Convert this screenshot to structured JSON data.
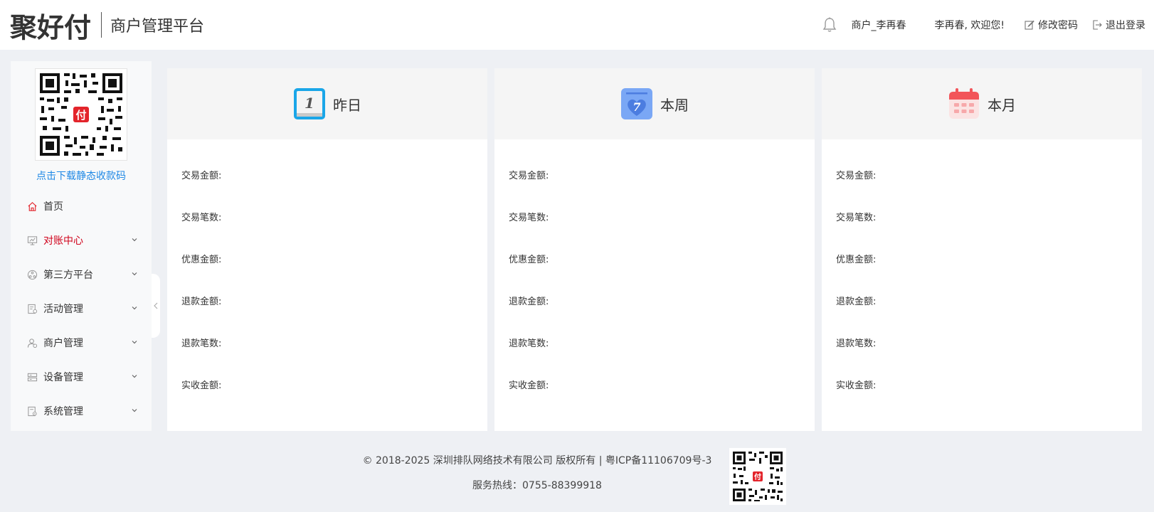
{
  "header": {
    "logo_text": "聚好付",
    "platform_title": "商户管理平台",
    "merchant_name": "商户_李再春",
    "welcome": "李再春, 欢迎您!",
    "change_password": "修改密码",
    "logout": "退出登录"
  },
  "sidebar": {
    "qr_link": "点击下载静态收款码",
    "qr_center_glyph": "付",
    "items": [
      {
        "label": "首页",
        "icon": "home-icon",
        "expandable": false,
        "active": false
      },
      {
        "label": "对账中心",
        "icon": "monitor-icon",
        "expandable": true,
        "active": true
      },
      {
        "label": "第三方平台",
        "icon": "network-icon",
        "expandable": true,
        "active": false
      },
      {
        "label": "活动管理",
        "icon": "activity-icon",
        "expandable": true,
        "active": false
      },
      {
        "label": "商户管理",
        "icon": "merchant-icon",
        "expandable": true,
        "active": false
      },
      {
        "label": "设备管理",
        "icon": "device-icon",
        "expandable": true,
        "active": false
      },
      {
        "label": "系统管理",
        "icon": "settings-doc-icon",
        "expandable": true,
        "active": false
      }
    ]
  },
  "cards": [
    {
      "title": "昨日",
      "icon": "calendar-day-1-icon",
      "icon_text": "1"
    },
    {
      "title": "本周",
      "icon": "calendar-week-7-icon",
      "icon_text": "7"
    },
    {
      "title": "本月",
      "icon": "calendar-month-icon"
    }
  ],
  "stat_labels": [
    "交易金额:",
    "交易笔数:",
    "优惠金额:",
    "退款金额:",
    "退款笔数:",
    "实收金额:"
  ],
  "footer": {
    "copyright": "© 2018-2025 深圳排队网络技术有限公司 版权所有 | 粤ICP备11106709号-3",
    "hotline": "服务热线：0755-88399918"
  },
  "colors": {
    "accent": "#d0021b",
    "link": "#1e88e5",
    "background": "#eef0f4"
  }
}
